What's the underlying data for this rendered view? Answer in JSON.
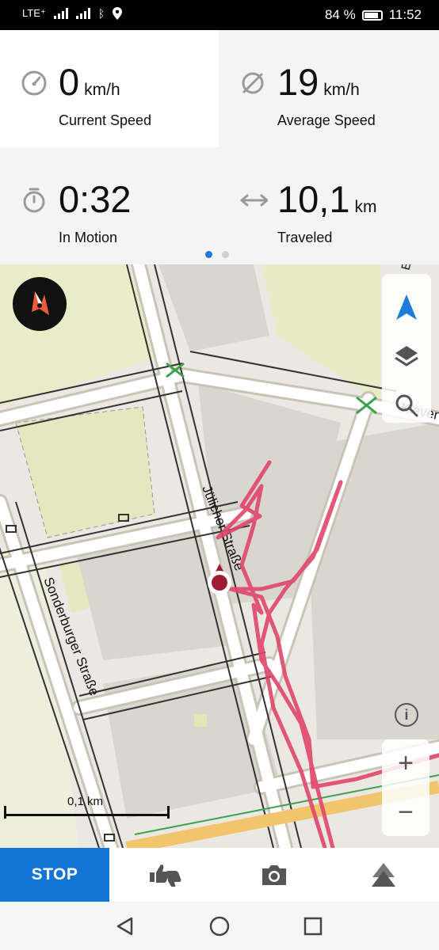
{
  "status_bar": {
    "network_label": "LTE⁺",
    "battery_percent": "84 %",
    "time": "11:52"
  },
  "stats": {
    "current_speed": {
      "value": "0",
      "unit": "km/h",
      "label": "Current Speed",
      "icon": "speedometer-icon"
    },
    "average_speed": {
      "value": "19",
      "unit": "km/h",
      "label": "Average Speed",
      "icon": "average-icon"
    },
    "in_motion": {
      "value": "0:32",
      "unit": "",
      "label": "In Motion",
      "icon": "stopwatch-icon"
    },
    "traveled": {
      "value": "10,1",
      "unit": "km",
      "label": "Traveled",
      "icon": "distance-arrows-icon"
    },
    "page_indicator": {
      "pages": 2,
      "active": 0
    }
  },
  "map": {
    "street_labels": [
      "Jülicher Straße",
      "Sonderburger Straße",
      "Klever",
      "Euler"
    ],
    "scale_label": "0,1 km",
    "colors": {
      "track": "#e0476b",
      "location": "#9e1b32",
      "accent": "#1e7bd9"
    }
  },
  "actions": {
    "stop_label": "STOP"
  }
}
